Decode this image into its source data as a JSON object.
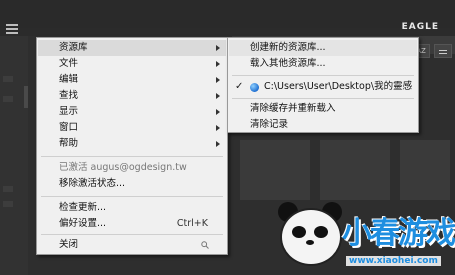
{
  "app": {
    "brand": "EAGLE"
  },
  "menu": {
    "items": [
      {
        "label": "资源库",
        "submenu": true,
        "hover": true
      },
      {
        "label": "文件",
        "submenu": true
      },
      {
        "label": "编辑",
        "submenu": true
      },
      {
        "label": "查找",
        "submenu": true
      },
      {
        "label": "显示",
        "submenu": true
      },
      {
        "label": "窗口",
        "submenu": true
      },
      {
        "label": "帮助",
        "submenu": true
      }
    ],
    "activated_label": "已激活 augus@ogdesign.tw",
    "remove_activation": "移除激活状态...",
    "check_updates": "检查更新...",
    "preferences": "偏好设置...",
    "preferences_shortcut": "Ctrl+K",
    "close": "关闭"
  },
  "submenu": {
    "create_library": "创建新的资源库...",
    "load_library": "载入其他资源库...",
    "current_library_path": "C:\\Users\\User\\Desktop\\我的靈感",
    "clear_cache_reload": "清除缓存并重新载入",
    "clear_history": "清除记录"
  },
  "toolbar": {
    "sort_label": "AZ"
  },
  "watermark": {
    "title": "小春游戏",
    "url": "www.xiaohei.com"
  },
  "icons": [
    "hamburger-icon",
    "submenu-arrow-icon",
    "checkmark-icon",
    "globe-icon",
    "search-icon",
    "filter-icon"
  ],
  "colors": {
    "menu_bg": "#f0f0f0",
    "app_bg": "#2b2b2b",
    "hover": "#dadada",
    "watermark_blue": "#1e8ee0"
  }
}
